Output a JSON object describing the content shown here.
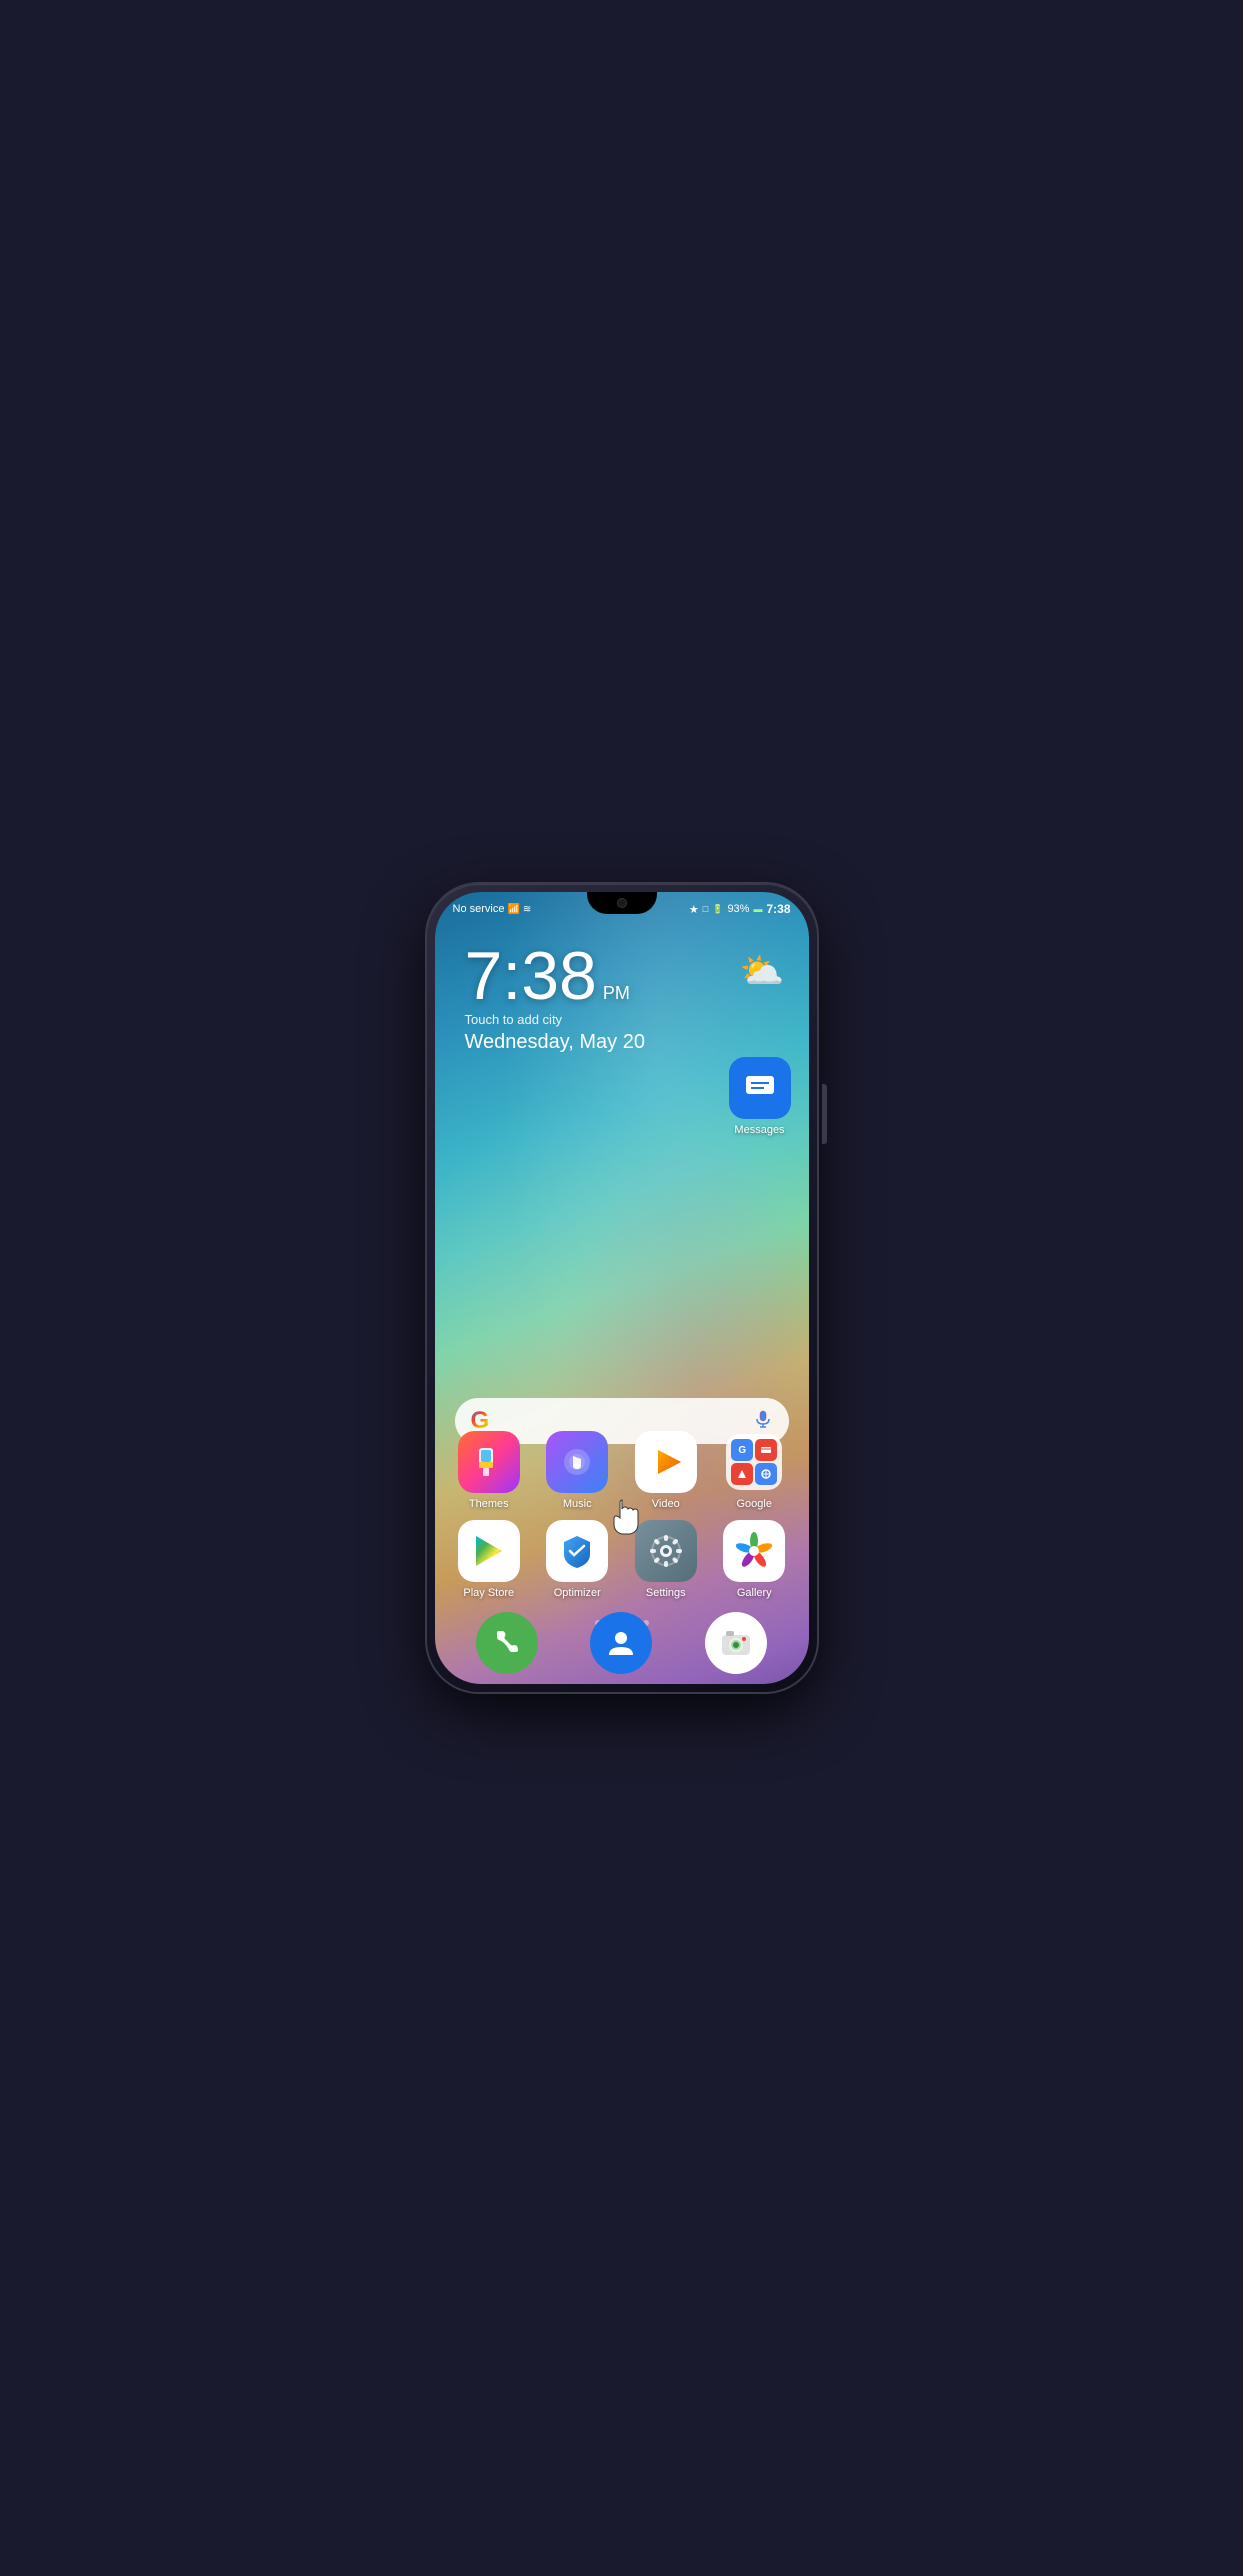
{
  "status_bar": {
    "left": "No service",
    "battery": "93%",
    "time": "7:38",
    "signal_icon": "📶",
    "wifi_icon": "🌐",
    "bluetooth_icon": "🔵"
  },
  "clock": {
    "time": "7:38",
    "ampm": "PM",
    "subtitle": "Touch to add city",
    "date": "Wednesday, May 20"
  },
  "weather": {
    "icon": "⛅"
  },
  "search": {
    "google_letter": "G",
    "mic_label": "mic"
  },
  "messages_app": {
    "label": "Messages"
  },
  "app_row1": [
    {
      "name": "themes",
      "label": "Themes",
      "icon_type": "themes"
    },
    {
      "name": "music",
      "label": "Music",
      "icon_type": "music"
    },
    {
      "name": "video",
      "label": "Video",
      "icon_type": "video"
    },
    {
      "name": "google",
      "label": "Google",
      "icon_type": "google"
    }
  ],
  "app_row2": [
    {
      "name": "playstore",
      "label": "Play Store",
      "icon_type": "playstore"
    },
    {
      "name": "optimizer",
      "label": "Optimizer",
      "icon_type": "optimizer"
    },
    {
      "name": "settings",
      "label": "Settings",
      "icon_type": "settings"
    },
    {
      "name": "gallery",
      "label": "Gallery",
      "icon_type": "gallery"
    }
  ],
  "dock": [
    {
      "name": "phone",
      "label": "Phone",
      "icon_type": "phone"
    },
    {
      "name": "contacts",
      "label": "Contacts",
      "icon_type": "contacts"
    },
    {
      "name": "camera",
      "label": "Camera",
      "icon_type": "camera"
    }
  ],
  "page_dots": [
    "dot1",
    "dot2",
    "dot3",
    "dot4",
    "dot5"
  ],
  "active_dot": 1
}
